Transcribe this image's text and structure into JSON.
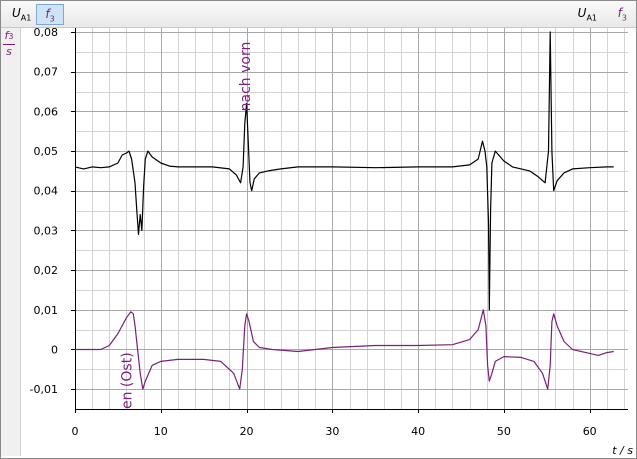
{
  "toolbar": {
    "left_items": [
      {
        "symbol": "U",
        "subscript": "A1"
      },
      {
        "symbol": "f",
        "subscript": "3",
        "selected": true
      }
    ],
    "right_items": [
      {
        "symbol": "U",
        "subscript": "A1"
      },
      {
        "symbol": "f",
        "subscript": "3"
      }
    ]
  },
  "y_unit": {
    "numerator": "f",
    "numerator_sub": "3",
    "denominator": "s"
  },
  "chart_data": {
    "type": "line",
    "xlabel": "t / s",
    "xlim": [
      0,
      64
    ],
    "ylim": [
      -0.015,
      0.08
    ],
    "x_ticks": [
      0,
      10,
      20,
      30,
      40,
      50,
      60
    ],
    "y_ticks": [
      -0.01,
      0,
      0.01,
      0.02,
      0.03,
      0.04,
      0.05,
      0.06,
      0.07,
      0.08
    ],
    "y_tick_labels": [
      "-0,01",
      "0",
      "0,01",
      "0,02",
      "0,03",
      "0,04",
      "0,05",
      "0,06",
      "0,07",
      "0,08"
    ],
    "grid": true,
    "colors": {
      "u_series": "#000000",
      "f_series": "#7a1f7a",
      "grid": "#a8a8a8",
      "accent": "#7a1f7a"
    },
    "series": [
      {
        "name": "U_A1",
        "color": "#000000",
        "points": [
          [
            0,
            0.046
          ],
          [
            1,
            0.0455
          ],
          [
            2,
            0.046
          ],
          [
            3,
            0.0458
          ],
          [
            4,
            0.046
          ],
          [
            5,
            0.047
          ],
          [
            5.5,
            0.049
          ],
          [
            6,
            0.0495
          ],
          [
            6.3,
            0.05
          ],
          [
            6.6,
            0.048
          ],
          [
            7.0,
            0.042
          ],
          [
            7.2,
            0.035
          ],
          [
            7.4,
            0.029
          ],
          [
            7.6,
            0.034
          ],
          [
            7.8,
            0.03
          ],
          [
            8.0,
            0.041
          ],
          [
            8.2,
            0.048
          ],
          [
            8.5,
            0.05
          ],
          [
            9,
            0.0485
          ],
          [
            10,
            0.047
          ],
          [
            11,
            0.0462
          ],
          [
            12,
            0.046
          ],
          [
            14,
            0.046
          ],
          [
            16,
            0.046
          ],
          [
            18,
            0.0455
          ],
          [
            18.8,
            0.044
          ],
          [
            19.3,
            0.042
          ],
          [
            19.6,
            0.046
          ],
          [
            19.8,
            0.057
          ],
          [
            20.0,
            0.062
          ],
          [
            20.2,
            0.052
          ],
          [
            20.4,
            0.042
          ],
          [
            20.6,
            0.04
          ],
          [
            20.9,
            0.043
          ],
          [
            21.5,
            0.0445
          ],
          [
            22.5,
            0.045
          ],
          [
            24,
            0.0455
          ],
          [
            26,
            0.046
          ],
          [
            30,
            0.046
          ],
          [
            35,
            0.0458
          ],
          [
            40,
            0.046
          ],
          [
            44,
            0.046
          ],
          [
            46,
            0.0465
          ],
          [
            47,
            0.048
          ],
          [
            47.5,
            0.0525
          ],
          [
            47.8,
            0.05
          ],
          [
            48.0,
            0.046
          ],
          [
            48.2,
            0.032
          ],
          [
            48.3,
            0.01
          ],
          [
            48.45,
            0.035
          ],
          [
            48.6,
            0.047
          ],
          [
            49,
            0.05
          ],
          [
            50,
            0.0475
          ],
          [
            51,
            0.046
          ],
          [
            52,
            0.0455
          ],
          [
            53,
            0.045
          ],
          [
            54,
            0.0435
          ],
          [
            54.8,
            0.042
          ],
          [
            55.2,
            0.05
          ],
          [
            55.4,
            0.08
          ],
          [
            55.6,
            0.05
          ],
          [
            55.8,
            0.04
          ],
          [
            56.2,
            0.0425
          ],
          [
            57,
            0.0445
          ],
          [
            58,
            0.0455
          ],
          [
            60,
            0.0458
          ],
          [
            62,
            0.046
          ],
          [
            62.8,
            0.046
          ]
        ]
      },
      {
        "name": "f3",
        "color": "#7a1f7a",
        "points": [
          [
            0,
            0
          ],
          [
            3,
            0
          ],
          [
            4,
            0.001
          ],
          [
            5,
            0.004
          ],
          [
            6,
            0.008
          ],
          [
            6.5,
            0.0095
          ],
          [
            6.8,
            0.009
          ],
          [
            7.0,
            0.006
          ],
          [
            7.3,
            0.0
          ],
          [
            7.6,
            -0.006
          ],
          [
            7.9,
            -0.01
          ],
          [
            8.2,
            -0.008
          ],
          [
            9,
            -0.004
          ],
          [
            10,
            -0.003
          ],
          [
            12,
            -0.0025
          ],
          [
            15,
            -0.0025
          ],
          [
            17,
            -0.003
          ],
          [
            18.5,
            -0.006
          ],
          [
            19.2,
            -0.01
          ],
          [
            19.5,
            -0.005
          ],
          [
            19.8,
            0.006
          ],
          [
            20.0,
            0.009
          ],
          [
            20.3,
            0.007
          ],
          [
            20.8,
            0.002
          ],
          [
            21.5,
            0.0005
          ],
          [
            23,
            0.0
          ],
          [
            26,
            -0.0005
          ],
          [
            28,
            0
          ],
          [
            30,
            0.0005
          ],
          [
            35,
            0.001
          ],
          [
            40,
            0.001
          ],
          [
            44,
            0.0012
          ],
          [
            46,
            0.0025
          ],
          [
            47,
            0.005
          ],
          [
            47.6,
            0.01
          ],
          [
            47.9,
            0.006
          ],
          [
            48.1,
            -0.004
          ],
          [
            48.3,
            -0.008
          ],
          [
            48.6,
            -0.006
          ],
          [
            49,
            -0.003
          ],
          [
            50,
            -0.0018
          ],
          [
            52,
            -0.002
          ],
          [
            53.5,
            -0.003
          ],
          [
            54.5,
            -0.006
          ],
          [
            55.1,
            -0.01
          ],
          [
            55.4,
            -0.004
          ],
          [
            55.6,
            0.007
          ],
          [
            55.8,
            0.009
          ],
          [
            56.2,
            0.006
          ],
          [
            57,
            0.002
          ],
          [
            58,
            0.0
          ],
          [
            60,
            -0.001
          ],
          [
            61,
            -0.0015
          ],
          [
            62,
            -0.0008
          ],
          [
            62.8,
            -0.0005
          ]
        ]
      }
    ],
    "annotations": [
      {
        "text": "nach vorn",
        "x": 19.8,
        "y": 0.06,
        "color": "#7a1f7a",
        "orientation": "vertical"
      },
      {
        "text": "en (Ost)",
        "x": 6.0,
        "y": -0.015,
        "color": "#7a1f7a",
        "orientation": "vertical"
      }
    ]
  }
}
